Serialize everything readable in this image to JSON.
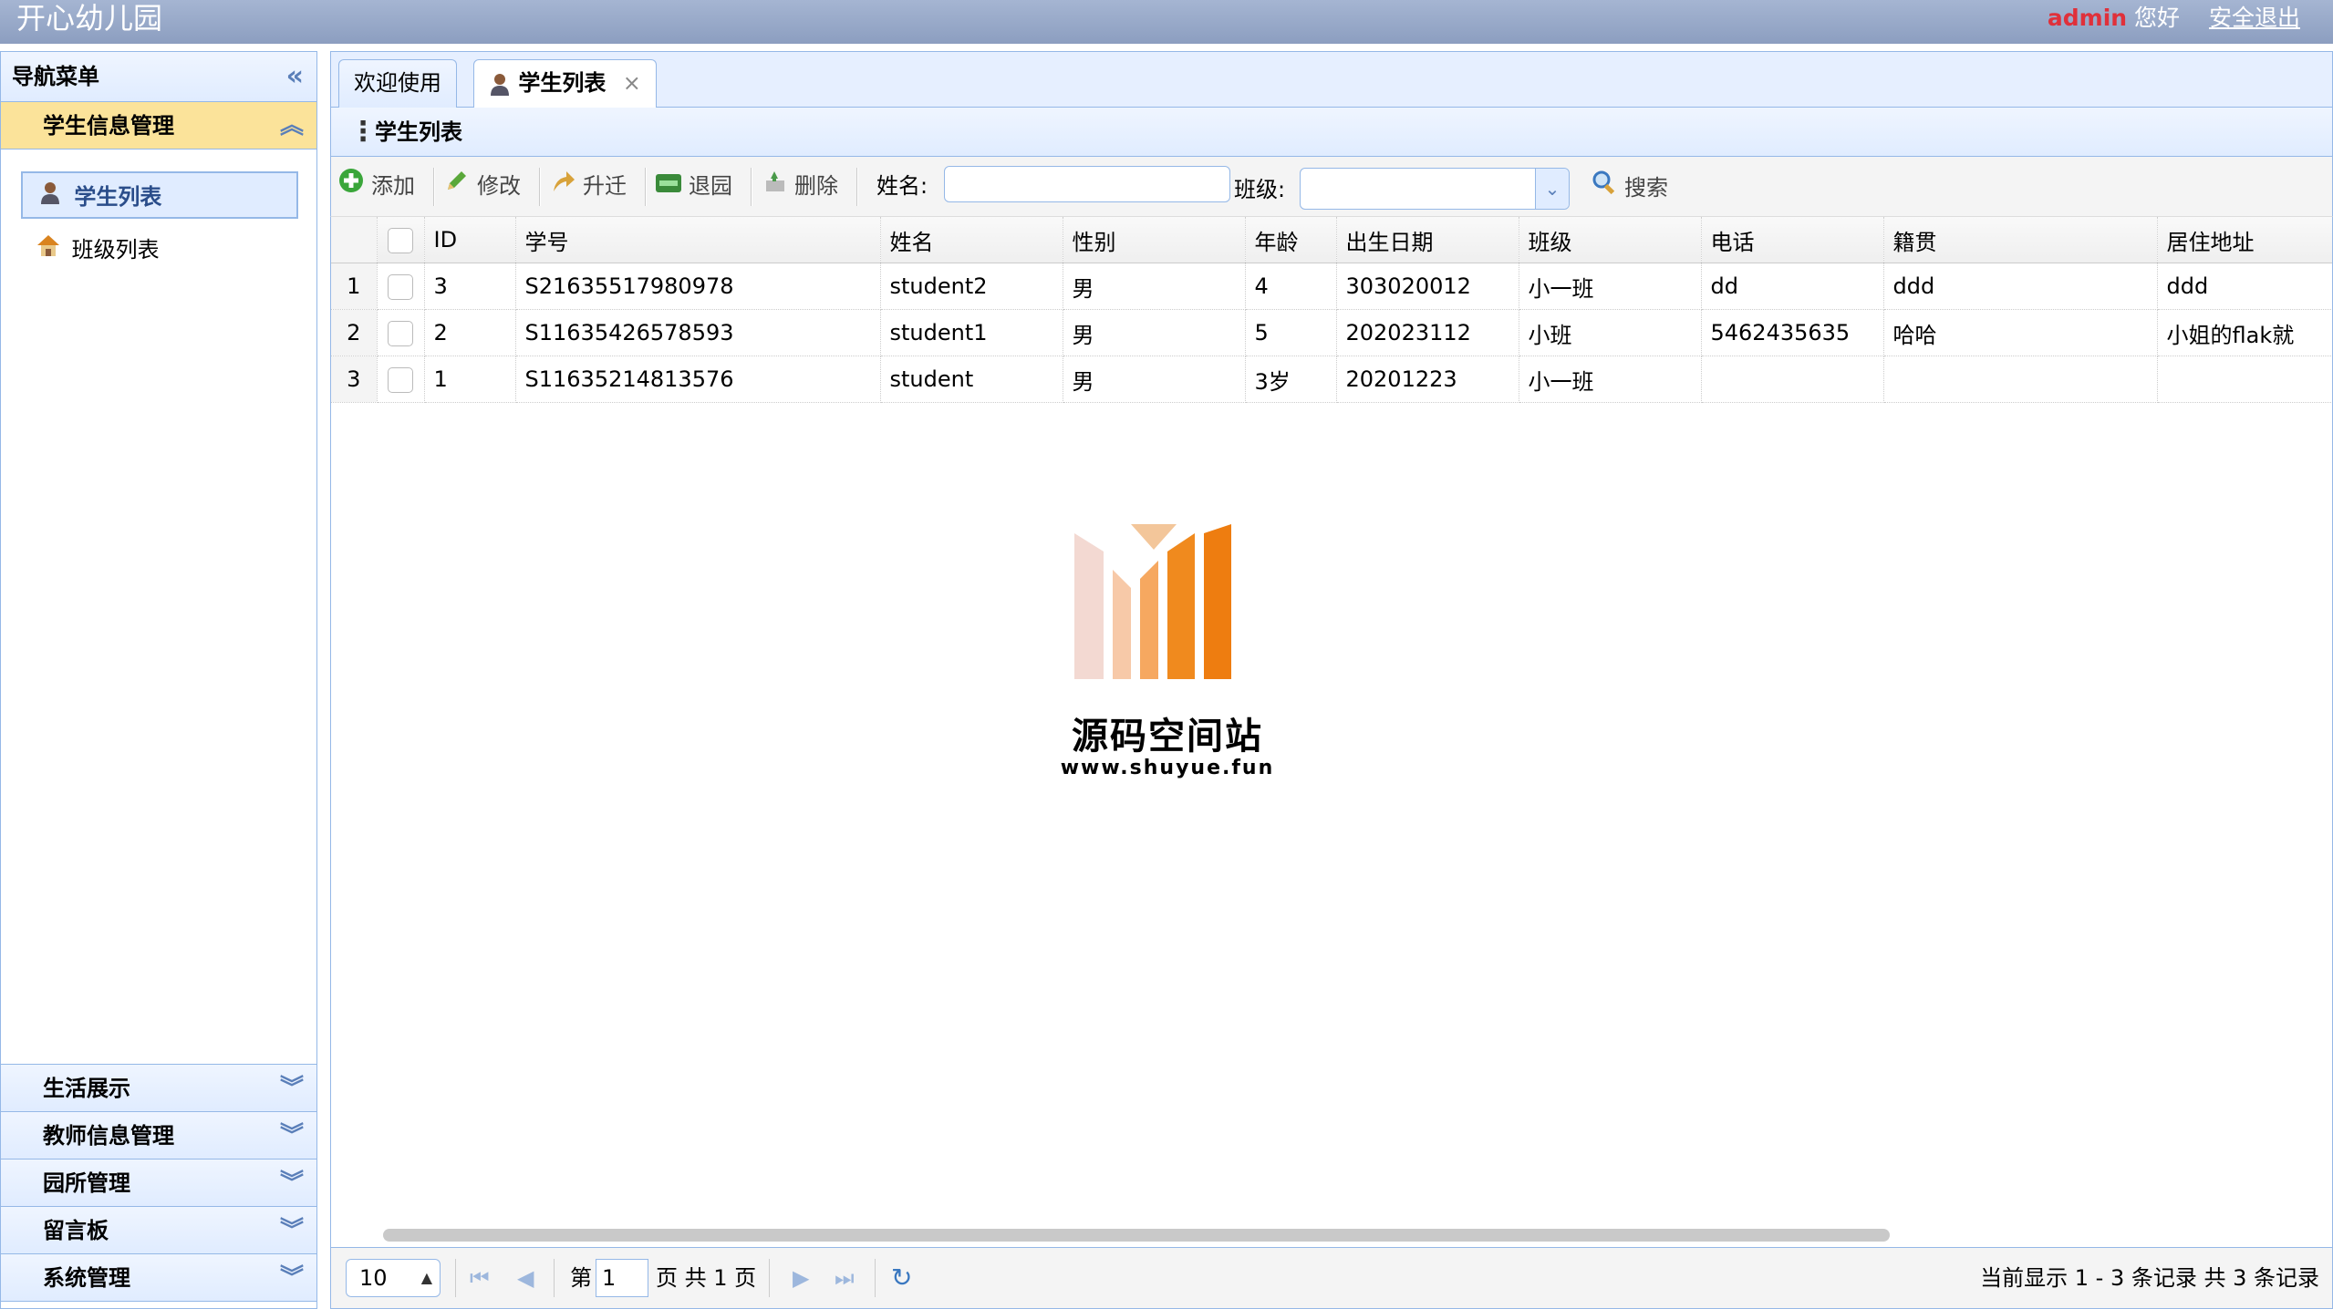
{
  "app": {
    "title": "开心幼儿园"
  },
  "user": {
    "name": "admin",
    "greeting": "您好",
    "logout": "安全退出"
  },
  "sidebar": {
    "header": "导航菜单",
    "active_section": "学生信息管理",
    "items": [
      {
        "label": "学生列表",
        "icon": "student-icon"
      },
      {
        "label": "班级列表",
        "icon": "house-icon"
      }
    ],
    "sections": [
      "生活展示",
      "教师信息管理",
      "园所管理",
      "留言板",
      "系统管理"
    ]
  },
  "tabs": [
    {
      "label": "欢迎使用"
    },
    {
      "label": "学生列表",
      "close": "×"
    }
  ],
  "panel": {
    "title": "学生列表"
  },
  "toolbar": {
    "add": "添加",
    "edit": "修改",
    "promote": "升迁",
    "withdraw": "退园",
    "delete": "删除",
    "name_label": "姓名:",
    "name_value": "",
    "class_label": "班级:",
    "class_value": "",
    "search": "搜索"
  },
  "table": {
    "columns": [
      "ID",
      "学号",
      "姓名",
      "性别",
      "年龄",
      "出生日期",
      "班级",
      "电话",
      "籍贯",
      "居住地址"
    ],
    "rows": [
      {
        "rn": "1",
        "id": "3",
        "sno": "S21635517980978",
        "name": "student2",
        "gender": "男",
        "age": "4",
        "birth": "303020012",
        "cls": "小一班",
        "phone": "dd",
        "native": "ddd",
        "addr": "ddd"
      },
      {
        "rn": "2",
        "id": "2",
        "sno": "S11635426578593",
        "name": "student1",
        "gender": "男",
        "age": "5",
        "birth": "202023112",
        "cls": "小班",
        "phone": "5462435635",
        "native": "哈哈",
        "addr": "小姐的flak就"
      },
      {
        "rn": "3",
        "id": "1",
        "sno": "S11635214813576",
        "name": "student",
        "gender": "男",
        "age": "3岁",
        "birth": "20201223",
        "cls": "小一班",
        "phone": "",
        "native": "",
        "addr": ""
      }
    ]
  },
  "watermark": {
    "title": "源码空间站",
    "url": "www.shuyue.fun"
  },
  "pager": {
    "page_size": "10",
    "page_prefix": "第",
    "page_value": "1",
    "page_suffix": "页 共 1 页",
    "info": "当前显示 1 - 3 条记录 共 3 条记录"
  },
  "colors": {
    "topbar": "#8c9ec0",
    "accent_border": "#95b8e7",
    "active_section": "#fbe39a",
    "admin": "#e0303a"
  }
}
